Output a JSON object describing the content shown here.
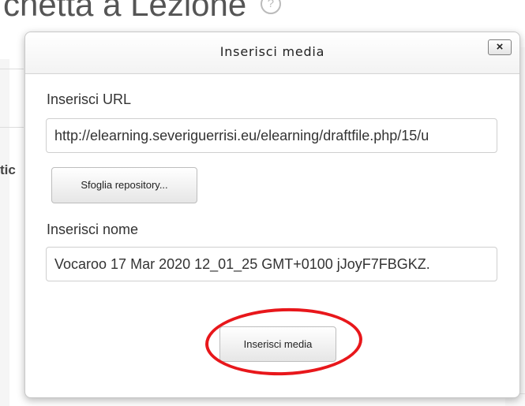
{
  "background": {
    "title": "chetta a Lezione",
    "help_icon": "?",
    "fragment": "tic"
  },
  "dialog": {
    "title": "Inserisci media",
    "close_icon": "×",
    "url_label": "Inserisci URL",
    "url_value": "http://elearning.severiguerrisi.eu/elearning/draftfile.php/15/u",
    "browse_label": "Sfoglia repository...",
    "name_label": "Inserisci nome",
    "name_value": "Vocaroo 17 Mar 2020 12_01_25 GMT+0100 jJoyF7FBGKZ.",
    "insert_label": "Inserisci media"
  },
  "annotation": {
    "color": "#e8171b"
  }
}
